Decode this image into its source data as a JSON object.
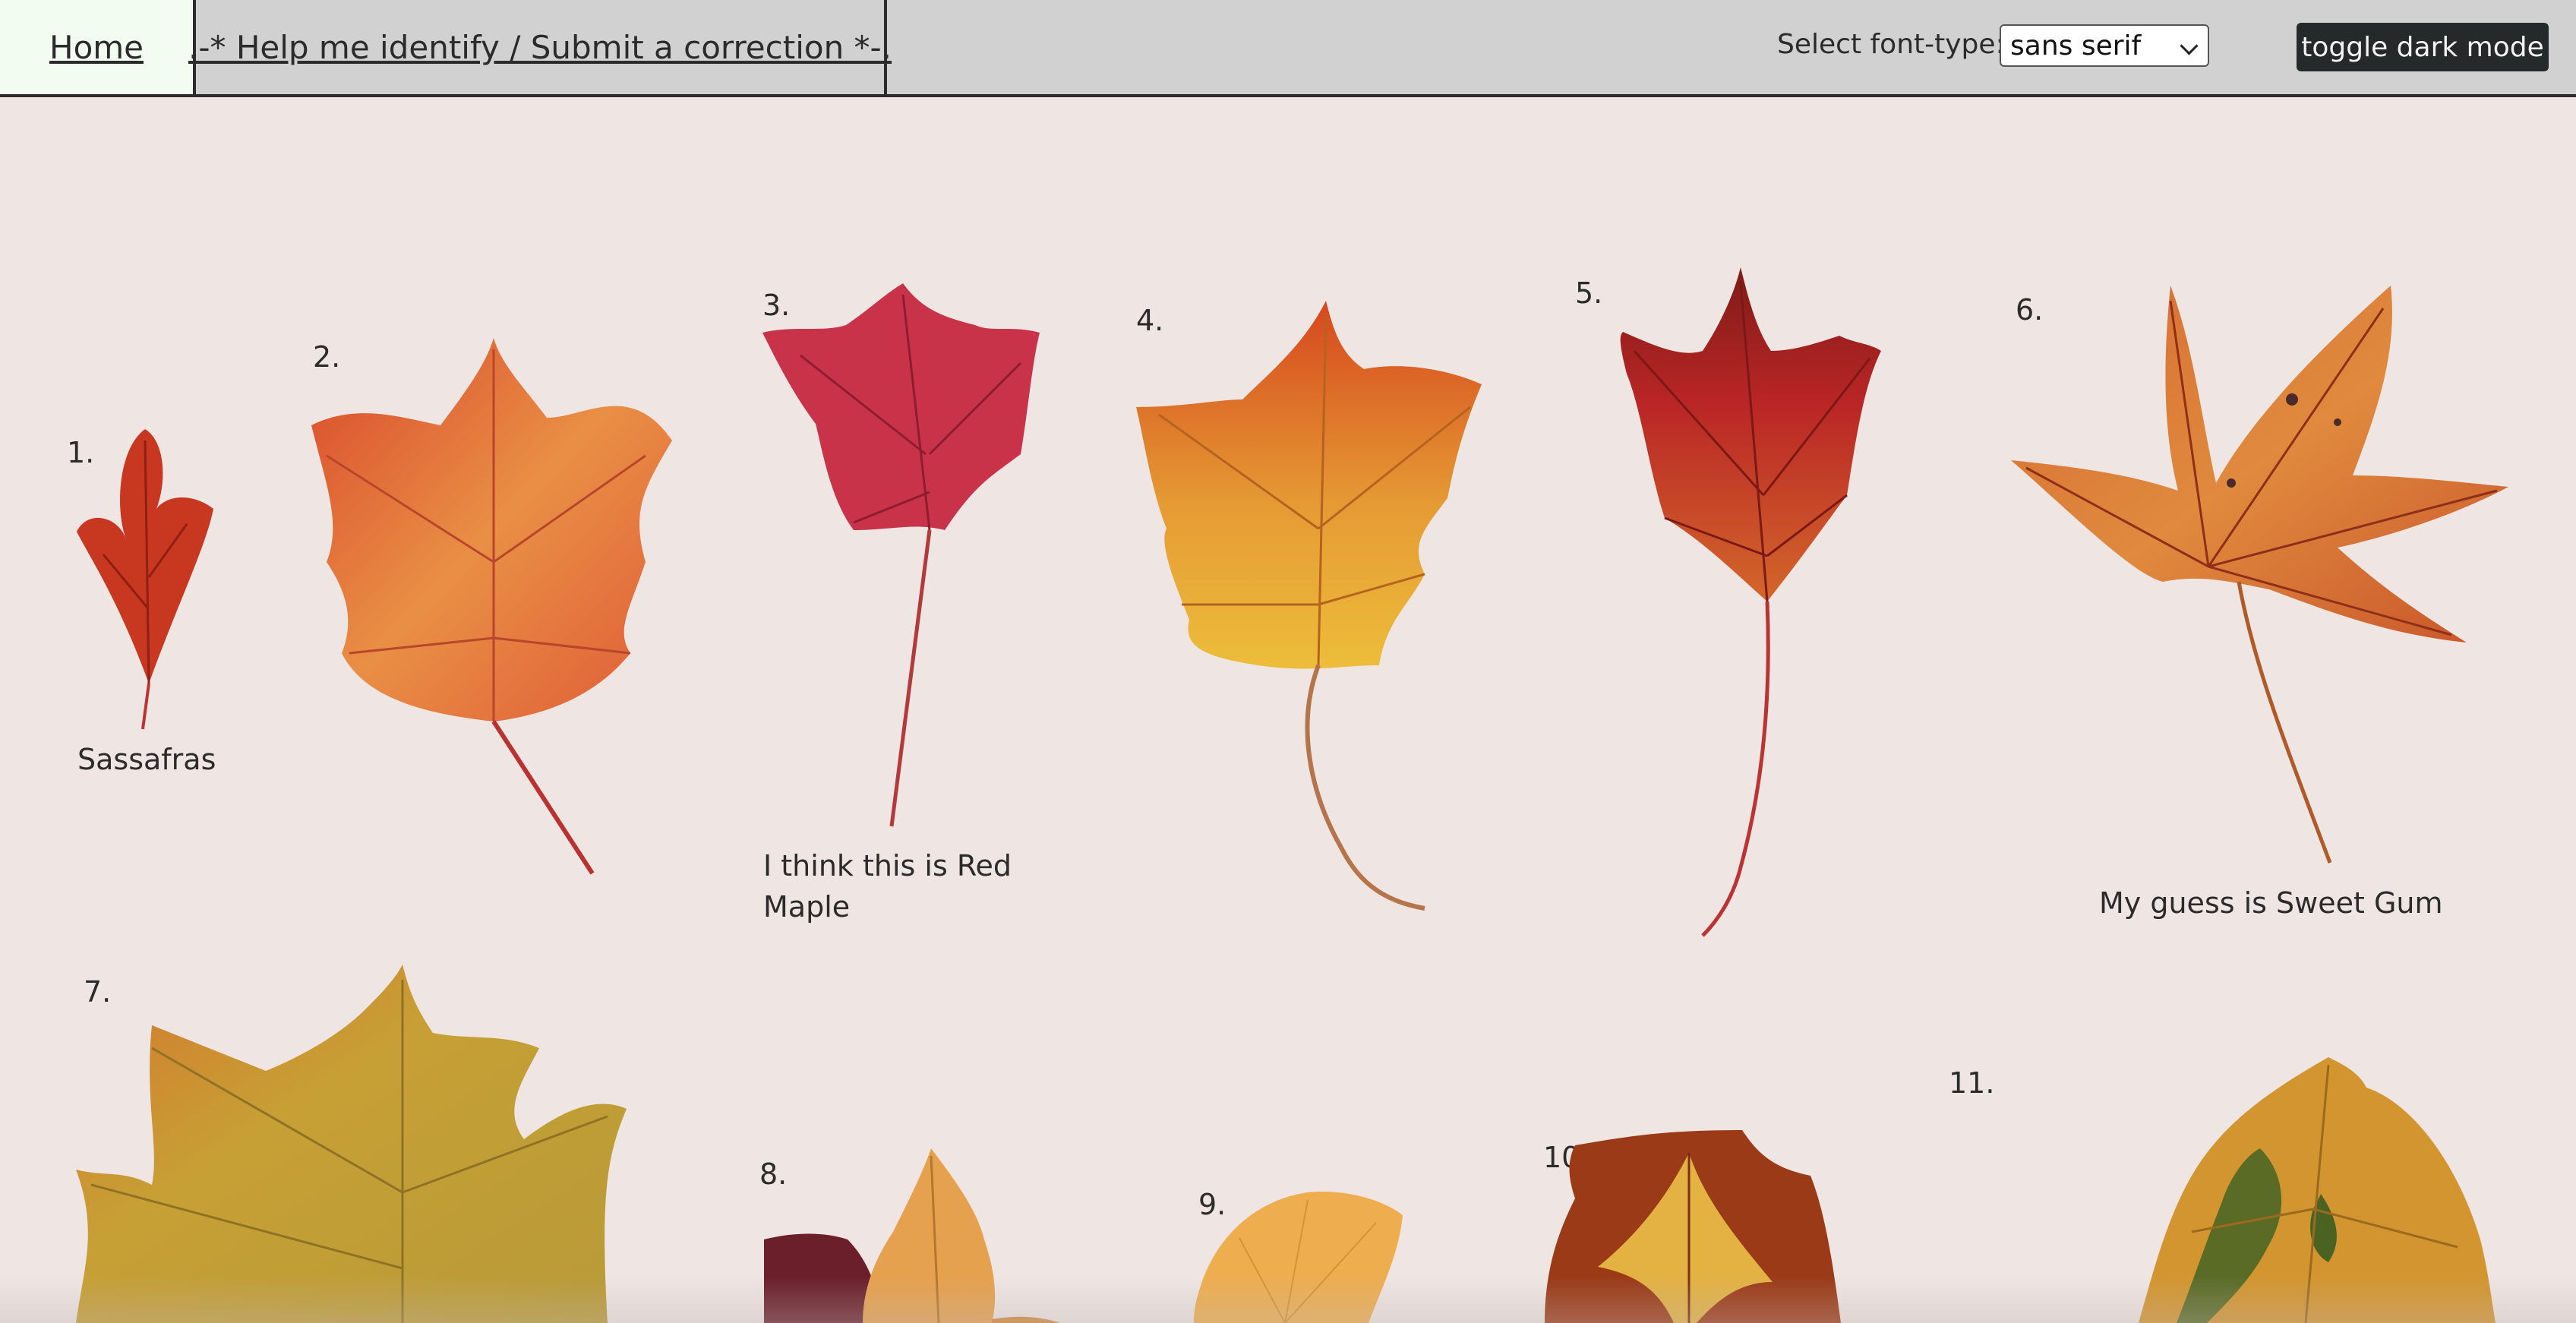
{
  "nav": {
    "home": "Home",
    "help": ".-* Help me identify / Submit a correction *-."
  },
  "controls": {
    "font_label": "Select font-type:",
    "font_selected": "sans serif",
    "dark_mode": "toggle dark mode"
  },
  "leaves": [
    {
      "number": "1.",
      "caption": "Sassafras"
    },
    {
      "number": "2.",
      "caption": ""
    },
    {
      "number": "3.",
      "caption": "I think this is Red Maple"
    },
    {
      "number": "4.",
      "caption": ""
    },
    {
      "number": "5.",
      "caption": ""
    },
    {
      "number": "6.",
      "caption": "My guess is Sweet Gum"
    },
    {
      "number": "7.",
      "caption": ""
    },
    {
      "number": "8.",
      "caption": ""
    },
    {
      "number": "9.",
      "caption": ""
    },
    {
      "number": "10.",
      "caption": ""
    },
    {
      "number": "11.",
      "caption": ""
    }
  ],
  "colors": {
    "page_bg": "#efe5e3",
    "topbar_bg": "#d1d1d1",
    "home_bg": "#f3fcf1",
    "button_bg": "#25292a"
  }
}
